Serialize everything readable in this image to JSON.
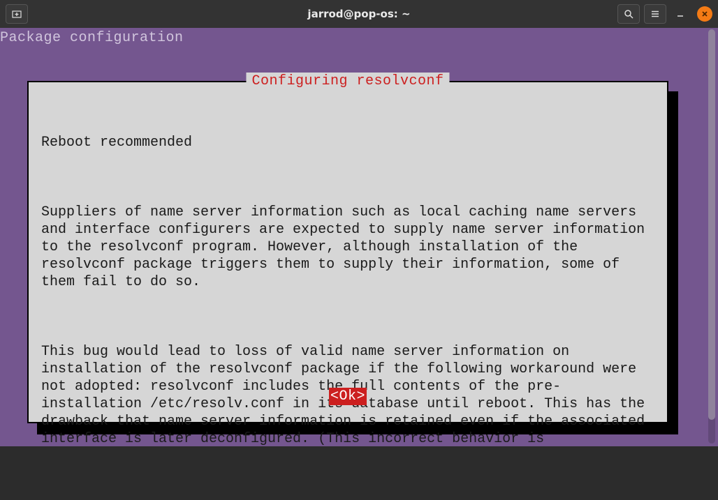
{
  "titlebar": {
    "title": "jarrod@pop-os: ~"
  },
  "terminal": {
    "header": "Package configuration"
  },
  "dialog": {
    "title": " Configuring resolvconf ",
    "heading": "Reboot recommended",
    "para1": "Suppliers of name server information such as local caching name servers and interface configurers are expected to supply name server information to the resolvconf program. However, although installation of the resolvconf package triggers them to supply their information, some of them fail to do so.",
    "para2": "This bug would lead to loss of valid name server information on installation of the resolvconf package if the following workaround were not adopted: resolvconf includes the full contents of the pre-installation /etc/resolv.conf in its database until reboot. This has the drawback that name server information is retained even if the associated interface is later deconfigured. (This incorrect behavior is",
    "ok_label": "<Ok>"
  }
}
